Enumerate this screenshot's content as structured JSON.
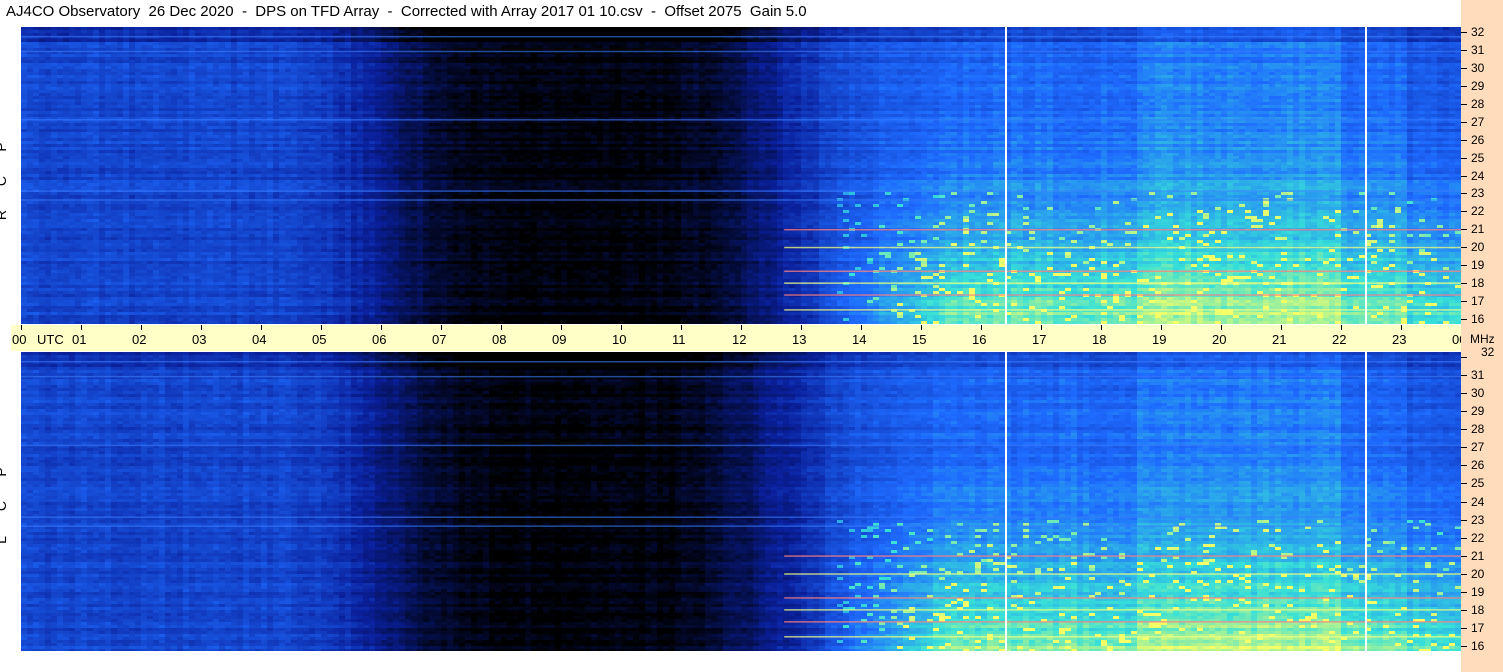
{
  "title": "AJ4CO Observatory  26 Dec 2020  -  DPS on TFD Array  -  Corrected with Array 2017 01 10.csv  -  Offset 2075  Gain 5.0",
  "panels": {
    "top_label": [
      "R",
      "C",
      "P"
    ],
    "bottom_label": [
      "L",
      "C",
      "P"
    ]
  },
  "time_axis": {
    "unit": "UTC",
    "ticks": [
      "00",
      "01",
      "02",
      "03",
      "04",
      "05",
      "06",
      "07",
      "08",
      "09",
      "10",
      "11",
      "12",
      "13",
      "14",
      "15",
      "16",
      "17",
      "18",
      "19",
      "20",
      "21",
      "22",
      "23",
      "00"
    ]
  },
  "freq_axis": {
    "unit": "MHz",
    "ticks": [
      "32",
      "31",
      "30",
      "29",
      "28",
      "27",
      "26",
      "25",
      "24",
      "23",
      "22",
      "21",
      "20",
      "19",
      "18",
      "17",
      "16"
    ]
  },
  "colors": {
    "background_dark": "#000000",
    "low": "#0a1f9a",
    "mid": "#1e6bff",
    "high": "#37e0d8",
    "peak": "#f7ff66",
    "time_bar": "#ffffc8",
    "freq_bar": "#fedcbc"
  },
  "chart_data": {
    "type": "heatmap",
    "title": "AJ4CO Observatory  26 Dec 2020  -  DPS on TFD Array  -  Corrected with Array 2017 01 10.csv  -  Offset 2075  Gain 5.0",
    "xlabel": "UTC",
    "ylabel": "MHz",
    "x_range_utc_hours": [
      0,
      24
    ],
    "y_range_mhz": [
      16,
      32
    ],
    "panels": [
      "RCP",
      "LCP"
    ],
    "features": {
      "night_dark_region_utc": [
        6.5,
        13.5
      ],
      "bright_broadband_utc": [
        13.5,
        24
      ],
      "vertical_lines_utc": [
        16.4,
        22.4
      ],
      "strong_low_freq_band_mhz": [
        16,
        22
      ]
    }
  }
}
